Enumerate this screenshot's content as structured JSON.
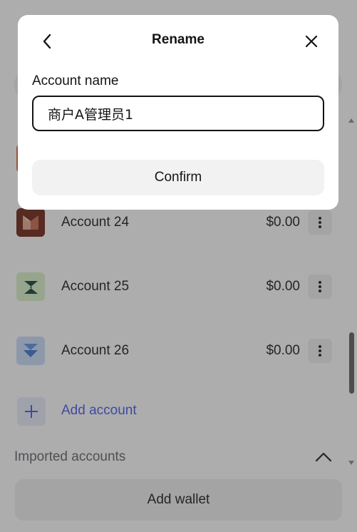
{
  "accounts": [
    {
      "name": "Account 24",
      "balance": "$0.00",
      "icon": "account-24-avatar",
      "color": "#6b1f0f"
    },
    {
      "name": "Account 25",
      "balance": "$0.00",
      "icon": "account-25-avatar",
      "color": "#d9f1c8"
    },
    {
      "name": "Account 26",
      "balance": "$0.00",
      "icon": "account-26-avatar",
      "color": "#c8dcfb"
    }
  ],
  "add_account": {
    "label": "Add account"
  },
  "imported": {
    "label": "Imported accounts"
  },
  "add_wallet": {
    "label": "Add wallet"
  },
  "modal": {
    "title": "Rename",
    "field_label": "Account name",
    "field_value": "商户A管理员1",
    "confirm_label": "Confirm"
  },
  "colors": {
    "accent": "#3f56e6",
    "overlay": "rgba(60,60,60,0.42)"
  }
}
